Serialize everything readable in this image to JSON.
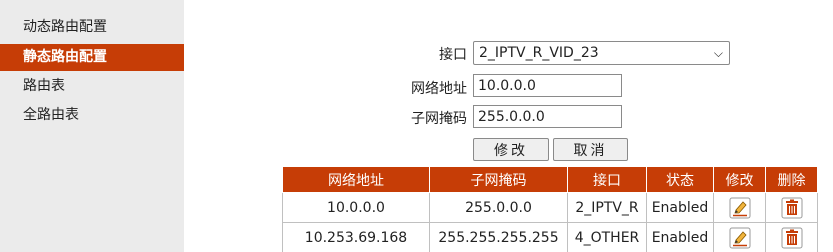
{
  "sidebar": {
    "items": [
      {
        "label": "动态路由配置",
        "active": false
      },
      {
        "label": "静态路由配置",
        "active": true
      },
      {
        "label": "路由表",
        "active": false
      },
      {
        "label": "全路由表",
        "active": false
      }
    ]
  },
  "form": {
    "interface_label": "接口",
    "interface_value": "2_IPTV_R_VID_23",
    "network_label": "网络地址",
    "network_value": "10.0.0.0",
    "mask_label": "子网掩码",
    "mask_value": "255.0.0.0",
    "edit_button": "修改",
    "cancel_button": "取消"
  },
  "table": {
    "headers": [
      "网络地址",
      "子网掩码",
      "接口",
      "状态",
      "修改",
      "删除"
    ],
    "rows": [
      {
        "network": "10.0.0.0",
        "mask": "255.0.0.0",
        "interface": "2_IPTV_R",
        "status": "Enabled"
      },
      {
        "network": "10.253.69.168",
        "mask": "255.255.255.255",
        "interface": "4_OTHER",
        "status": "Enabled"
      }
    ]
  },
  "colors": {
    "accent": "#c63d06",
    "sidebar_bg": "#ebebeb"
  },
  "icons": {
    "select_arrow": "chevron-down-icon",
    "edit": "pencil-edit-icon",
    "delete": "trash-icon"
  }
}
